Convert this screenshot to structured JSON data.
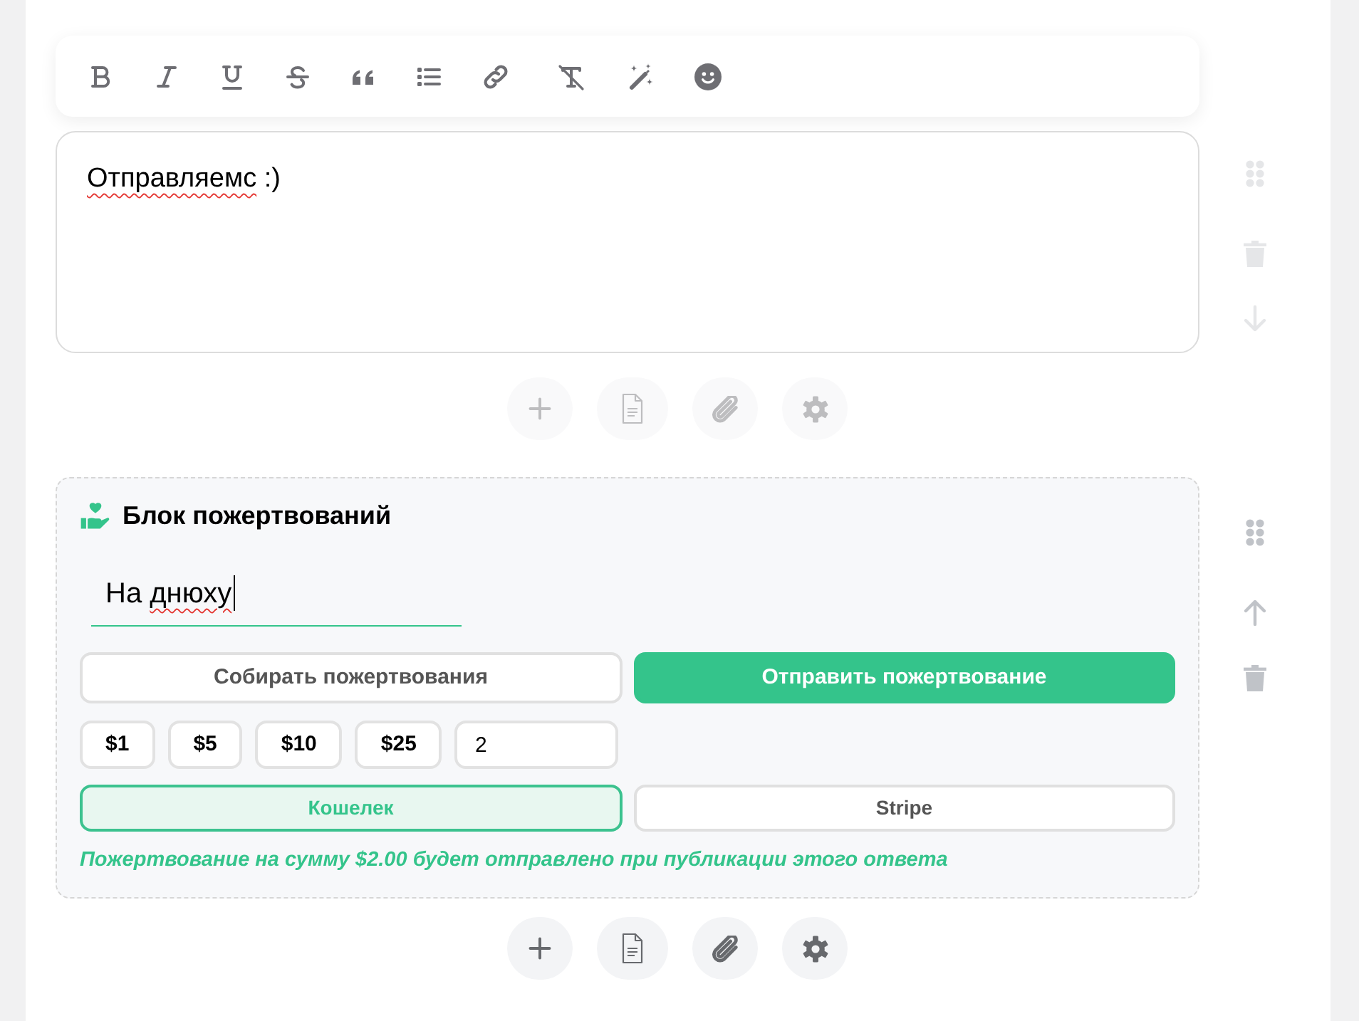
{
  "blocks": [
    {
      "kind": "text",
      "active": false,
      "can_move_up": false,
      "can_move_down": true,
      "content": [
        {
          "text": "Отправляемс",
          "misspelled": true
        },
        {
          "text": ":)",
          "misspelled": false
        }
      ]
    },
    {
      "kind": "donation",
      "active": true,
      "can_move_up": true,
      "can_move_down": false,
      "title": "Блок пожертвований",
      "text_field": {
        "focused": true,
        "value": [
          {
            "text": "На",
            "misspelled": false
          },
          {
            "text": "днюху",
            "misspelled": true
          }
        ]
      },
      "modes": [
        {
          "label": "Собирать пожертвования",
          "selected": false
        },
        {
          "label": "Отправить пожертвование",
          "selected": true
        }
      ],
      "amounts": [
        {
          "label": "$1",
          "selected": false
        },
        {
          "label": "$5",
          "selected": false
        },
        {
          "label": "$10",
          "selected": false
        },
        {
          "label": "$25",
          "selected": false
        }
      ],
      "custom_amount": {
        "value": "2"
      },
      "payment_methods": [
        {
          "label": "Кошелек",
          "selected": true
        },
        {
          "label": "Stripe",
          "selected": false
        }
      ],
      "note": "Пожертвование на сумму $2.00 будет отправлено при публикации этого ответа"
    }
  ]
}
